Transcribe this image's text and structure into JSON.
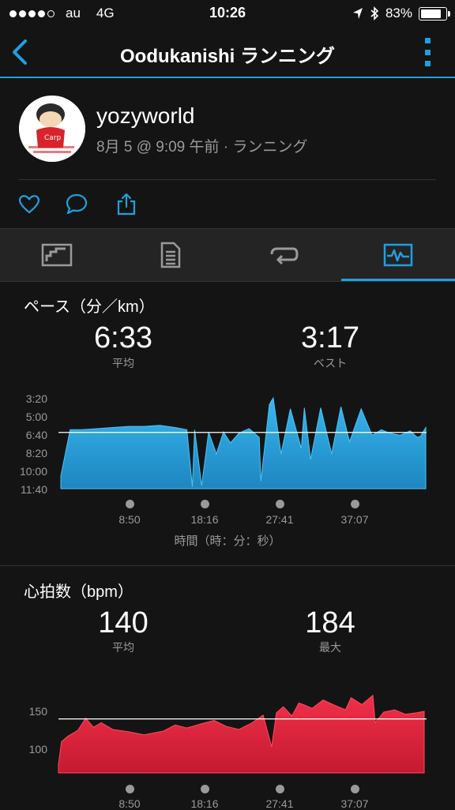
{
  "status_bar": {
    "carrier": "au",
    "network": "4G",
    "time": "10:26",
    "battery": "83%",
    "battery_level": 0.83
  },
  "nav": {
    "title": "Oodukanishi ランニング"
  },
  "profile": {
    "username": "yozyworld",
    "subline": "8月 5 @ 9:09 午前 · ランニング"
  },
  "tabs": [
    {
      "icon": "overview-icon",
      "active": false
    },
    {
      "icon": "details-icon",
      "active": false
    },
    {
      "icon": "laps-icon",
      "active": false
    },
    {
      "icon": "charts-icon",
      "active": true
    }
  ],
  "pace": {
    "title": "ペース（分／km）",
    "avg_value": "6:33",
    "avg_label": "平均",
    "best_value": "3:17",
    "best_label": "ベスト",
    "y_ticks": [
      "3:20",
      "5:00",
      "6:40",
      "8:20",
      "10:00",
      "11:40"
    ],
    "x_ticks": [
      "8:50",
      "18:16",
      "27:41",
      "37:07"
    ],
    "x_axis_title": "時間（時：分：秒）"
  },
  "heart_rate": {
    "title": "心拍数（bpm）",
    "avg_value": "140",
    "avg_label": "平均",
    "max_value": "184",
    "max_label": "最大",
    "y_ticks": [
      "150",
      "100"
    ],
    "x_ticks": [
      "8:50",
      "18:16",
      "27:41",
      "37:07"
    ]
  },
  "colors": {
    "accent": "#1ea0e0",
    "pace_fill": "#2aa6dc",
    "hr_fill": "#e0213a",
    "background": "#141414"
  },
  "chart_data": [
    {
      "type": "area",
      "title": "ペース（分／km）",
      "xlabel": "時間（時：分：秒）",
      "ylabel": "",
      "x_unit": "minutes",
      "y_unit": "minutes per km (inverted axis)",
      "ylim": [
        11.67,
        3.33
      ],
      "reference_line": 6.55,
      "series": [
        {
          "x": [
            0.3,
            1.5,
            3,
            5,
            7,
            9,
            11,
            13,
            15,
            16.5,
            17.2,
            17.5,
            18.4,
            19.3,
            20.3,
            21.2,
            22.1,
            23.2,
            24.5,
            25.8,
            26,
            27.1,
            27.6,
            28.6,
            29.8,
            31.2,
            31.6,
            32.4,
            33.7,
            35.1,
            36.3,
            37.4,
            38.9,
            40.3,
            41.5,
            42.5,
            43.9,
            45.2,
            46.1,
            46.5,
            47.2
          ],
          "values": [
            10.5,
            6.3,
            6.3,
            6.2,
            6.1,
            6.0,
            6.0,
            5.9,
            6.1,
            6.3,
            11.5,
            6.3,
            11.4,
            6.5,
            8.5,
            6.5,
            7.5,
            6.6,
            6.2,
            7.0,
            11.0,
            4.0,
            3.4,
            8.5,
            4.4,
            8.0,
            4.3,
            9.0,
            4.3,
            8.5,
            4.2,
            7.4,
            4.4,
            6.8,
            6.3,
            6.6,
            6.8,
            6.4,
            7.0,
            6.9,
            6.1
          ]
        }
      ]
    },
    {
      "type": "area",
      "title": "心拍数（bpm）",
      "xlabel": "",
      "ylabel": "",
      "x_unit": "minutes",
      "y_unit": "bpm",
      "ylim": [
        80,
        180
      ],
      "reference_line": 140,
      "series": [
        {
          "x": [
            0,
            0.4,
            1.2,
            2.5,
            3.5,
            4.5,
            5.5,
            7,
            9,
            11,
            13.5,
            15,
            16.5,
            18.5,
            20,
            21.6,
            23.2,
            24.9,
            26.3,
            27.4,
            28,
            28.9,
            30,
            30.9,
            31.7,
            32.6,
            34,
            35.5,
            36.9,
            37.6,
            39,
            40.4,
            40.7,
            41.8,
            43.2,
            44.6,
            46,
            47
          ],
          "values": [
            80,
            110,
            117,
            125,
            141,
            129,
            135,
            126,
            123,
            119,
            124,
            132,
            128,
            134,
            138,
            130,
            126,
            135,
            145,
            103,
            148,
            156,
            144,
            161,
            158,
            154,
            165,
            158,
            152,
            168,
            159,
            171,
            135,
            149,
            152,
            146,
            148,
            150
          ]
        }
      ]
    }
  ]
}
